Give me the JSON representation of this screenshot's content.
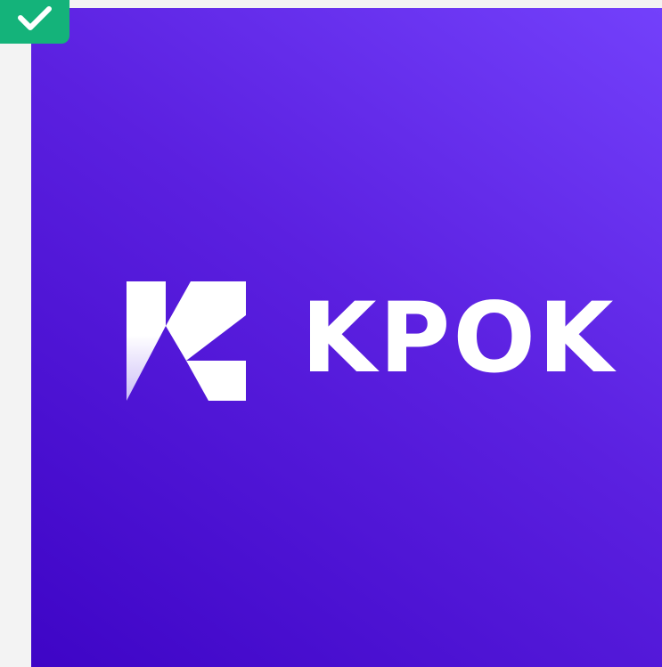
{
  "badge": {
    "icon": "checkmark-icon",
    "color": "#14b37a"
  },
  "logo": {
    "mark_icon": "kpok-k-mark-icon",
    "wordmark": "KPOK",
    "text_color": "#ffffff",
    "background_colors": [
      "#3e05c6",
      "#7340fb"
    ]
  }
}
